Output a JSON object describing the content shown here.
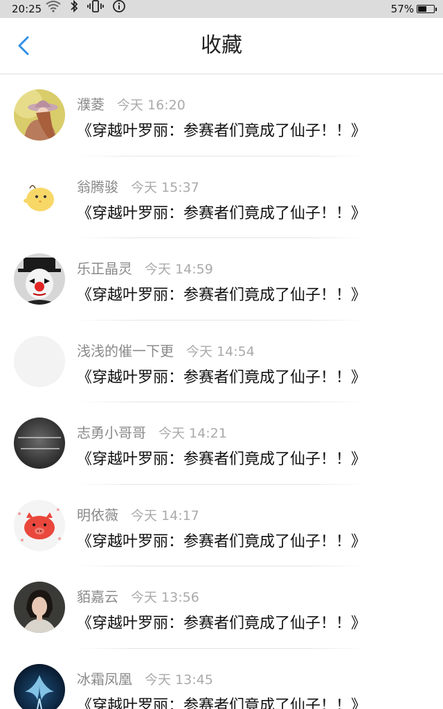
{
  "status_bar": {
    "time": "20:25",
    "battery_percent": "57%",
    "battery_level": 0.57,
    "icons": [
      "wifi-icon",
      "bluetooth-icon",
      "vibrate-icon",
      "info-icon"
    ]
  },
  "header": {
    "title": "收藏",
    "back_icon": "chevron-left-icon",
    "accent_color": "#2f8fe6"
  },
  "items": [
    {
      "user": "濮菱",
      "time": "今天 16:20",
      "title": "《穿越叶罗丽：参赛者们竟成了仙子！！》",
      "avatar": "girl-hat"
    },
    {
      "user": "翁腾骏",
      "time": "今天 15:37",
      "title": "《穿越叶罗丽：参赛者们竟成了仙子！！》",
      "avatar": "yellow-chick"
    },
    {
      "user": "乐正晶灵",
      "time": "今天 14:59",
      "title": "《穿越叶罗丽：参赛者们竟成了仙子！！》",
      "avatar": "clown"
    },
    {
      "user": "浅浅的催一下更",
      "time": "今天 14:54",
      "title": "《穿越叶罗丽：参赛者们竟成了仙子！！》",
      "avatar": "blank"
    },
    {
      "user": "志勇小哥哥",
      "time": "今天 14:21",
      "title": "《穿越叶罗丽：参赛者们竟成了仙子！！》",
      "avatar": "dark-text"
    },
    {
      "user": "明依薇",
      "time": "今天 14:17",
      "title": "《穿越叶罗丽：参赛者们竟成了仙子！！》",
      "avatar": "red-pig"
    },
    {
      "user": "貊嘉云",
      "time": "今天 13:56",
      "title": "《穿越叶罗丽：参赛者们竟成了仙子！！》",
      "avatar": "portrait"
    },
    {
      "user": "冰霜凤凰",
      "time": "今天 13:45",
      "title": "《穿越叶罗丽：参赛者们竟成了仙子！！》",
      "avatar": "phoenix"
    }
  ]
}
